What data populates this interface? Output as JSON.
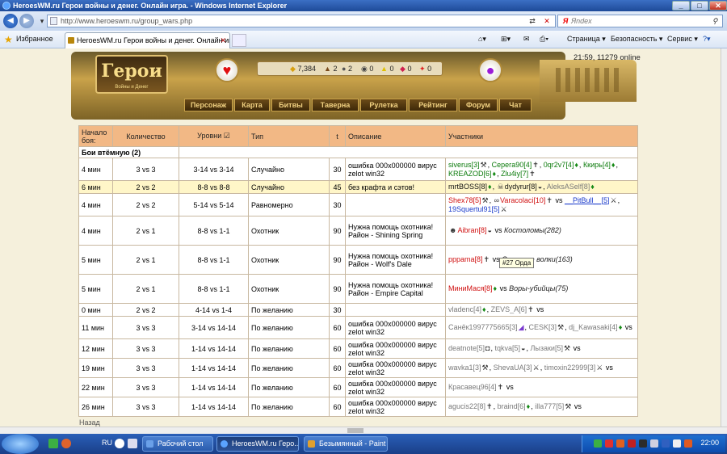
{
  "window": {
    "title": "HeroesWM.ru Герои войны и денег. Онлайн игра. - Windows Internet Explorer",
    "min": "_",
    "max": "□",
    "close": "✕"
  },
  "address": {
    "url": "http://www.heroeswm.ru/group_wars.php",
    "search_placeholder": "Яndex"
  },
  "favbar": {
    "favorites_label": "Избранное",
    "tab_title": "HeroesWM.ru Герои войны и денег. Онлайн иг...",
    "page_menu": "Страница ▾",
    "safety_menu": "Безопасность ▾",
    "service_menu": "Сервис ▾",
    "help": "?▾"
  },
  "game": {
    "logo_text": "Герои",
    "logo_sub": "Войны и Денег",
    "clock": "21:59, 11279 online",
    "resources": [
      {
        "icon": "gold-icon",
        "glyph": "◆",
        "value": "7,384"
      },
      {
        "icon": "wood-icon",
        "glyph": "▲",
        "value": "2"
      },
      {
        "icon": "ore-icon",
        "glyph": "●",
        "value": "2"
      },
      {
        "icon": "mercury-icon",
        "glyph": "◉",
        "value": "0"
      },
      {
        "icon": "sulfur-icon",
        "glyph": "▲",
        "value": "0"
      },
      {
        "icon": "crystal-icon",
        "glyph": "◆",
        "value": "0"
      },
      {
        "icon": "gem-icon",
        "glyph": "✦",
        "value": "0"
      }
    ],
    "nav": [
      "Персонаж",
      "Карта",
      "Битвы",
      "Таверна",
      "Рулетка",
      "Рейтинг",
      "Форум",
      "Чат"
    ]
  },
  "table": {
    "headers": [
      "Начало боя:",
      "Количество",
      "Уровни ☑",
      "Тип",
      "t",
      "Описание",
      "Участники"
    ],
    "section": "Бои втёмную (2)",
    "rows": [
      {
        "start": "4 мин",
        "count": "3 vs 3",
        "levels": "3-14 vs 3-14",
        "type": "Случайно",
        "t": "30",
        "desc": "ошибка 000x000000 вирус zelot win32"
      },
      {
        "start": "6 мин",
        "count": "2 vs 2",
        "levels": "8-8 vs 8-8",
        "type": "Случайно",
        "t": "45",
        "desc": "без крафта и сэтов!"
      },
      {
        "start": "4 мин",
        "count": "2 vs 2",
        "levels": "5-14 vs 5-14",
        "type": "Равномерно",
        "t": "30",
        "desc": ""
      },
      {
        "start": "4 мин",
        "count": "2 vs 1",
        "levels": "8-8 vs 1-1",
        "type": "Охотник",
        "t": "90",
        "desc": "Нужна помощь охотника! Район - Shining Spring"
      },
      {
        "start": "5 мин",
        "count": "2 vs 1",
        "levels": "8-8 vs 1-1",
        "type": "Охотник",
        "t": "90",
        "desc": "Нужна помощь охотника! Район - Wolf's Dale"
      },
      {
        "start": "5 мин",
        "count": "2 vs 1",
        "levels": "8-8 vs 1-1",
        "type": "Охотник",
        "t": "90",
        "desc": "Нужна помощь охотника! Район - Empire Capital"
      },
      {
        "start": "0 мин",
        "count": "2 vs 2",
        "levels": "4-14 vs 1-4",
        "type": "По желанию",
        "t": "30",
        "desc": ""
      },
      {
        "start": "11 мин",
        "count": "3 vs 3",
        "levels": "3-14 vs 14-14",
        "type": "По желанию",
        "t": "60",
        "desc": "ошибка 000x000000 вирус zelot win32"
      },
      {
        "start": "12 мин",
        "count": "3 vs 3",
        "levels": "1-14 vs 14-14",
        "type": "По желанию",
        "t": "60",
        "desc": "ошибка 000x000000 вирус zelot win32"
      },
      {
        "start": "19 мин",
        "count": "3 vs 3",
        "levels": "1-14 vs 14-14",
        "type": "По желанию",
        "t": "60",
        "desc": "ошибка 000x000000 вирус zelot win32"
      },
      {
        "start": "22 мин",
        "count": "3 vs 3",
        "levels": "1-14 vs 14-14",
        "type": "По желанию",
        "t": "60",
        "desc": "ошибка 000x000000 вирус zelot win32"
      },
      {
        "start": "26 мин",
        "count": "3 vs 3",
        "levels": "1-14 vs 14-14",
        "type": "По желанию",
        "t": "60",
        "desc": "ошибка 000x000000 вирус zelot win32"
      }
    ],
    "participants": {
      "r0": [
        "siverus[3]",
        "Серега90[4]",
        "0qr2v7[4]",
        "Ккирь[4]",
        "KREAZOD[6]",
        "Zlu4iy[7]"
      ],
      "r1": [
        "mrtBOSS[8]",
        "dydyrur[8]",
        "AleksASelf[8]"
      ],
      "r2": [
        "Shex78[5]",
        "Varacolaci[10]",
        "vs",
        "__PitBull__[5]",
        "19Squertul91[5]"
      ],
      "r3": [
        "Aibran[8]",
        "vs",
        "Костоломы(282)"
      ],
      "r4": [
        "pppama[8]",
        "vs",
        "Степные волки(163)"
      ],
      "r5": [
        "МиниМася[8]",
        "vs",
        "Воры-убийцы(75)"
      ],
      "r6": [
        "vladenc[4]",
        "ZEVS_A[6]",
        "vs"
      ],
      "r7": [
        "Санёк1997775665[3]",
        "CESK[3]",
        "dj_Kawasaki[4]",
        "vs"
      ],
      "r8": [
        "deatnote[5]",
        "tqkva[5]",
        "Лызаки[5]",
        "vs"
      ],
      "r9": [
        "wavka1[3]",
        "ShevaUA[3]",
        "timoxin22999[3]",
        "vs"
      ],
      "r10": [
        "Красавец96[4]",
        "vs"
      ],
      "r11": [
        "agucis22[8]",
        "braind[6]",
        "illa777[5]",
        "vs"
      ]
    },
    "tooltip": "#27 Орда"
  },
  "back": "Назад",
  "taskbar": {
    "lang": "RU",
    "tasks": [
      "Рабочий стол",
      "HeroesWM.ru Геро...",
      "Безымянный - Paint"
    ],
    "time": "22:00"
  }
}
